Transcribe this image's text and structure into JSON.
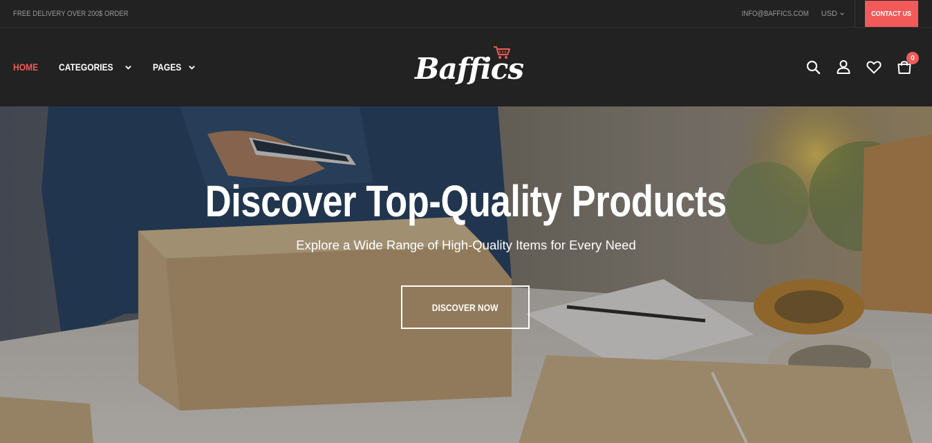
{
  "topbar": {
    "promo": "FREE DELIVERY OVER 200$ ORDER",
    "email": "INFO@BAFFICS.COM",
    "currency": "USD",
    "contact": "CONTACT US"
  },
  "header": {
    "logo_text": "Baffics",
    "nav": [
      {
        "label": "HOME",
        "active": true
      },
      {
        "label": "CATEGORIES",
        "has_dropdown": true
      },
      {
        "label": "PAGES",
        "has_dropdown": true
      }
    ],
    "icons": [
      "search-icon",
      "user-icon",
      "heart-icon",
      "bag-icon"
    ],
    "cart_count": "0"
  },
  "hero": {
    "title": "Discover Top-Quality Products",
    "subtitle": "Explore a Wide Range of High-Quality Items for Every Need",
    "button": "DISCOVER NOW"
  },
  "colors": {
    "accent": "#f25a5a",
    "dark": "#222222",
    "text": "#ffffff",
    "muted": "#9a9a9a"
  }
}
